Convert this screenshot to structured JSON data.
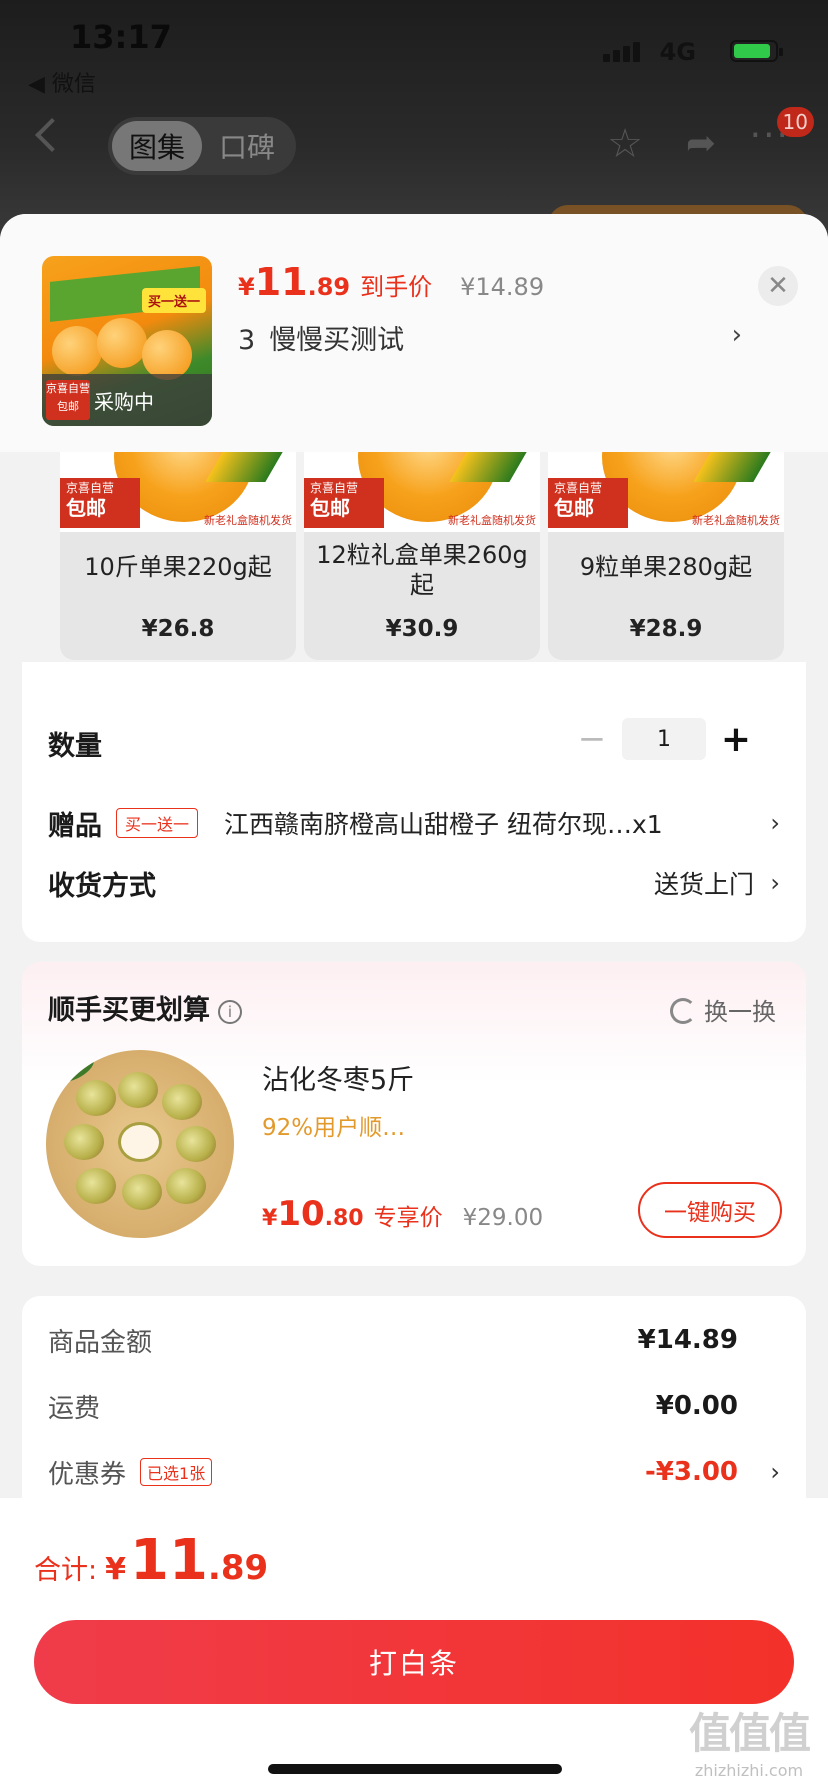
{
  "status_bar": {
    "time": "13:17",
    "back_app": "◀ 微信",
    "network": "4G"
  },
  "nav": {
    "tabs": [
      "图集",
      "口碑"
    ],
    "active_tab": 0,
    "badge_count": "10"
  },
  "selected_product": {
    "price_currency": "¥",
    "price_int": "11",
    "price_dec": ".89",
    "price_label": "到手价",
    "original_price": "¥14.89",
    "spec_index": "3",
    "spec_name": "慢慢买测试",
    "status_label": "采购中",
    "box_tag": "买一送一",
    "mini_label": "京喜自营 包邮"
  },
  "spec_options": [
    {
      "name": "10斤单果220g起",
      "price": "¥26.8",
      "tag_top": "京喜自营",
      "tag_bottom": "包邮",
      "note": "新老礼盒随机发货"
    },
    {
      "name": "12粒礼盒单果260g起",
      "price": "¥30.9",
      "tag_top": "京喜自营",
      "tag_bottom": "包邮",
      "note": "新老礼盒随机发货"
    },
    {
      "name": "9粒单果280g起",
      "price": "¥28.9",
      "tag_top": "京喜自营",
      "tag_bottom": "包邮",
      "note": "新老礼盒随机发货"
    }
  ],
  "quantity": {
    "label": "数量",
    "value": "1",
    "minus": "−",
    "plus": "+"
  },
  "gift": {
    "label": "赠品",
    "tag": "买一送一",
    "text": "江西赣南脐橙高山甜橙子 纽荷尔现…x1"
  },
  "delivery": {
    "label": "收货方式",
    "value": "送货上门"
  },
  "addon": {
    "title": "顺手买更划算",
    "swap_label": "换一换",
    "product_name": "沾化冬枣5斤",
    "subtitle": "92%用户顺…",
    "price_currency": "¥",
    "price_int": "10",
    "price_dec": ".80",
    "price_label": "专享价",
    "original_price": "¥29.00",
    "buy_label": "一键购买"
  },
  "summary": {
    "goods_label": "商品金额",
    "goods_value": "¥14.89",
    "shipping_label": "运费",
    "shipping_value": "¥0.00",
    "coupon_label": "优惠券",
    "coupon_tag": "已选1张",
    "coupon_value": "-¥3.00"
  },
  "footer": {
    "total_label": "合计:",
    "total_currency": "¥",
    "total_int": "11",
    "total_dec": ".89",
    "pay_button": "打白条"
  },
  "watermark": {
    "logo": "值值值",
    "site": "zhizhizhi.com"
  },
  "colors": {
    "accent": "#e9311c",
    "pay_button": "#f03c4a",
    "addon_subtitle": "#e39a2c"
  }
}
